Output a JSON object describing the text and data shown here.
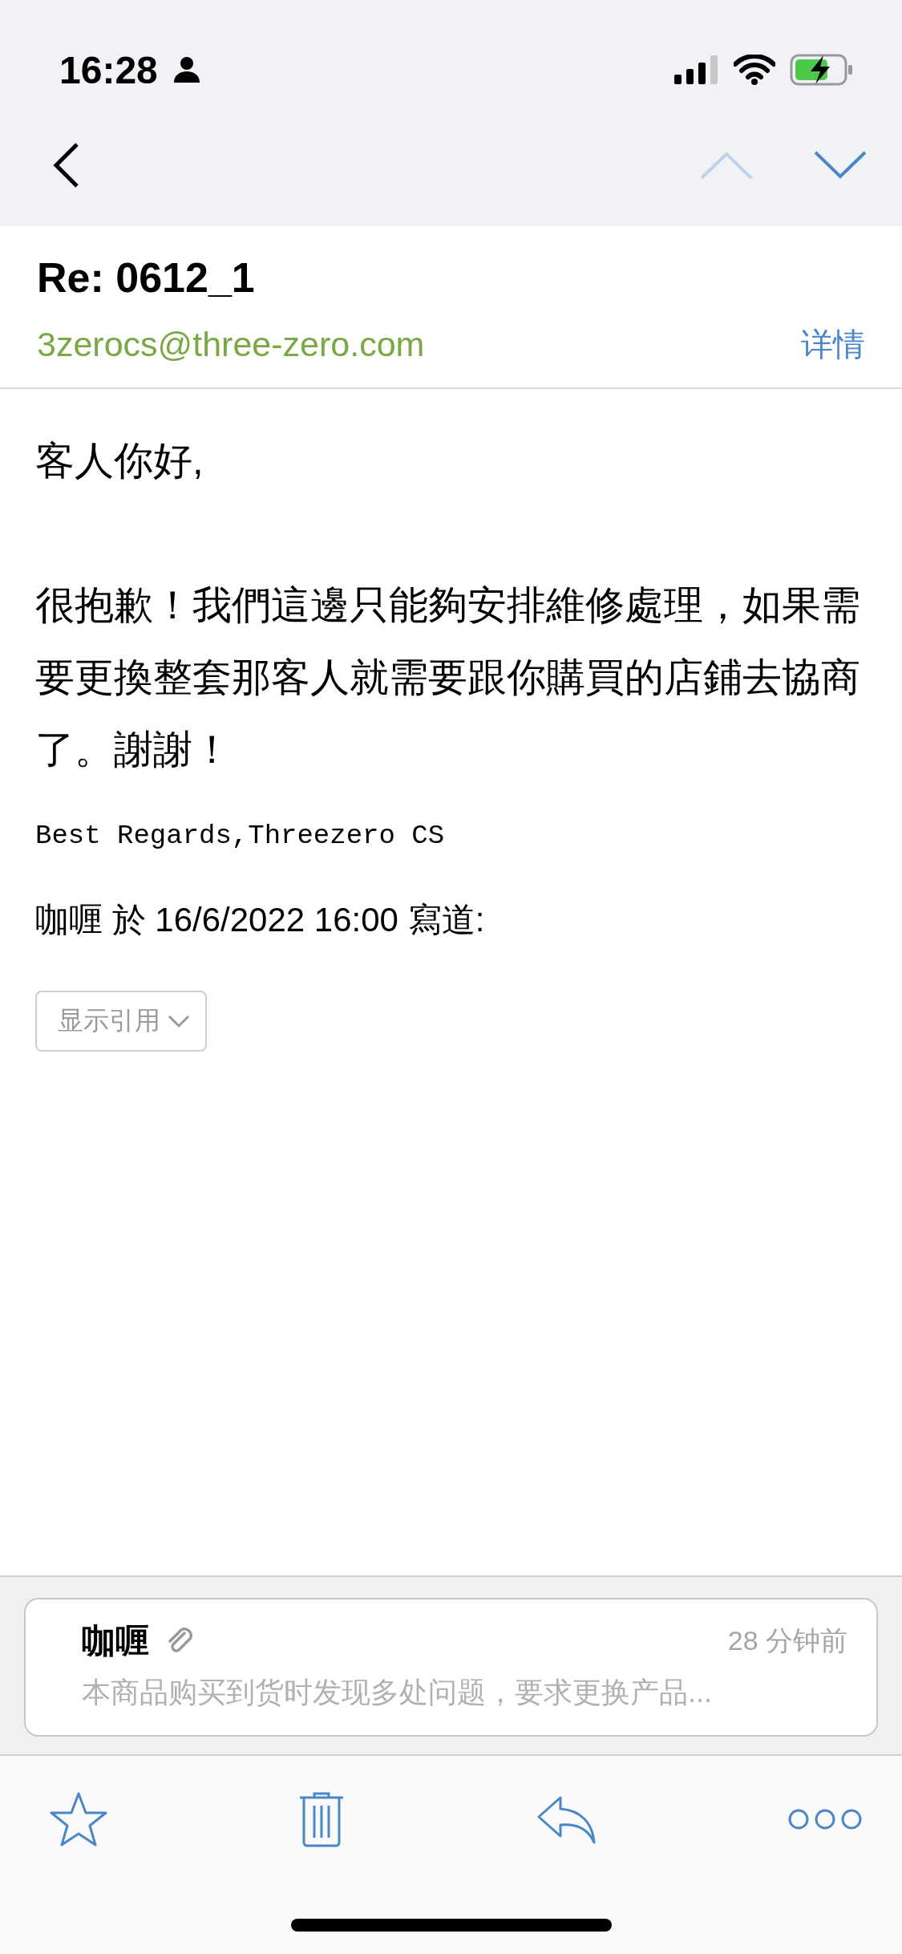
{
  "status_bar": {
    "time": "16:28"
  },
  "nav": {
    "prev": {
      "disabled": true
    },
    "next": {
      "disabled": false
    }
  },
  "header": {
    "subject": "Re: 0612_1",
    "sender": "3zerocs@three-zero.com",
    "details_link": "详情"
  },
  "body": {
    "greeting": "客人你好,",
    "paragraph": "很抱歉！我們這邊只能夠安排維修處理，如果需要更換整套那客人就需要跟你購買的店鋪去協商了。謝謝！",
    "signature": "Best Regards,Threezero CS",
    "quote_intro": "咖喱 於 16/6/2022 16:00 寫道:",
    "show_quote_button": "显示引用"
  },
  "thread_card": {
    "sender": "咖喱",
    "has_attachment": true,
    "time": "28 分钟前",
    "preview": "本商品购买到货时发现多处问题，要求更换产品..."
  }
}
